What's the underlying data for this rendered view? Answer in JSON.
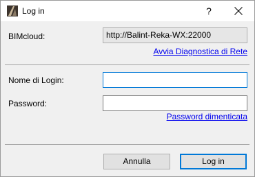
{
  "window": {
    "title": "Log in",
    "help_label": "?",
    "close_icon": "close-icon",
    "app_icon": "archicad-icon"
  },
  "server": {
    "label": "BIMcloud:",
    "value": "http://Balint-Reka-WX:22000",
    "diagnostics_link": "Avvia Diagnostica di Rete"
  },
  "login": {
    "username_label": "Nome di Login:",
    "username_value": "",
    "password_label": "Password:",
    "password_value": "",
    "forgot_link": "Password dimenticata"
  },
  "buttons": {
    "cancel_label": "Annulla",
    "login_label": "Log in"
  },
  "colors": {
    "accent": "#0078d7",
    "link": "#0000ee",
    "dialog_bg": "#f0f0f0"
  }
}
